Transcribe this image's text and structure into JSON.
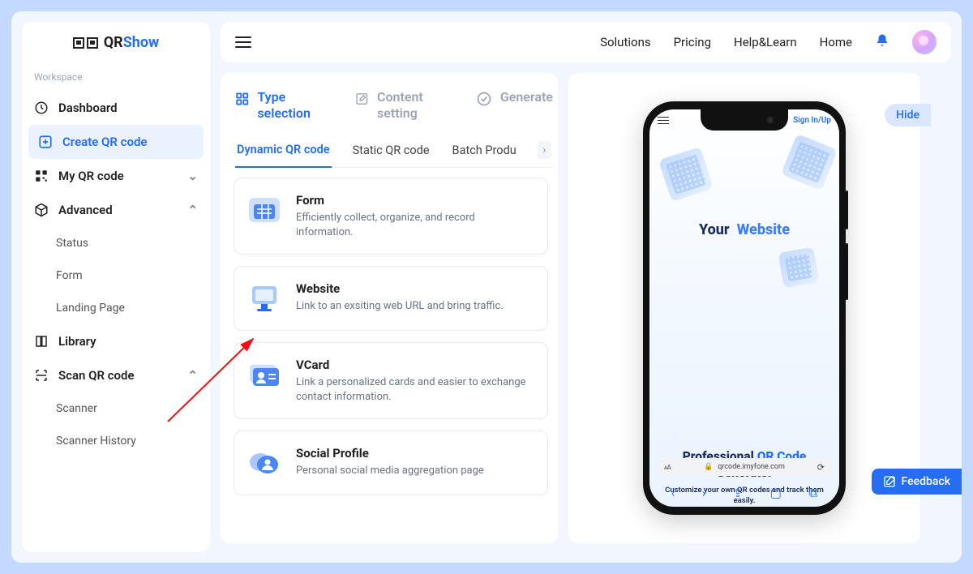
{
  "logo": {
    "qr": "QR",
    "show": "Show"
  },
  "workspace_label": "Workspace",
  "sidebar": {
    "dashboard": "Dashboard",
    "create": "Create QR code",
    "myqr": "My QR code",
    "advanced": "Advanced",
    "adv_sub": [
      "Status",
      "Form",
      "Landing Page"
    ],
    "library": "Library",
    "scan": "Scan QR code",
    "scan_sub": [
      "Scanner",
      "Scanner History"
    ]
  },
  "topbar": {
    "solutions": "Solutions",
    "pricing": "Pricing",
    "help": "Help&Learn",
    "home": "Home"
  },
  "steps": {
    "type": "Type selection",
    "content": "Content setting",
    "generate": "Generate"
  },
  "tabs": {
    "dynamic": "Dynamic QR code",
    "static": "Static QR code",
    "batch": "Batch Produ"
  },
  "types": [
    {
      "name": "Form",
      "desc": "Efficiently collect, organize, and record information."
    },
    {
      "name": "Website",
      "desc": "Link to an exsiting web URL and bring traffic."
    },
    {
      "name": "VCard",
      "desc": "Link a personalized cards and easier to exchange contact information."
    },
    {
      "name": "Social Profile",
      "desc": "Personal social media aggregation page"
    }
  ],
  "hide": "Hide",
  "phone": {
    "signin": "Sign In/Up",
    "your": "Your",
    "website": "Website",
    "pro1": "Professional ",
    "pro2": "QR Code",
    "pro3": "Generator",
    "sub": "Customize your own QR codes and track them easily.",
    "url": "qrcode.imyfone.com"
  },
  "feedback": "Feedback"
}
